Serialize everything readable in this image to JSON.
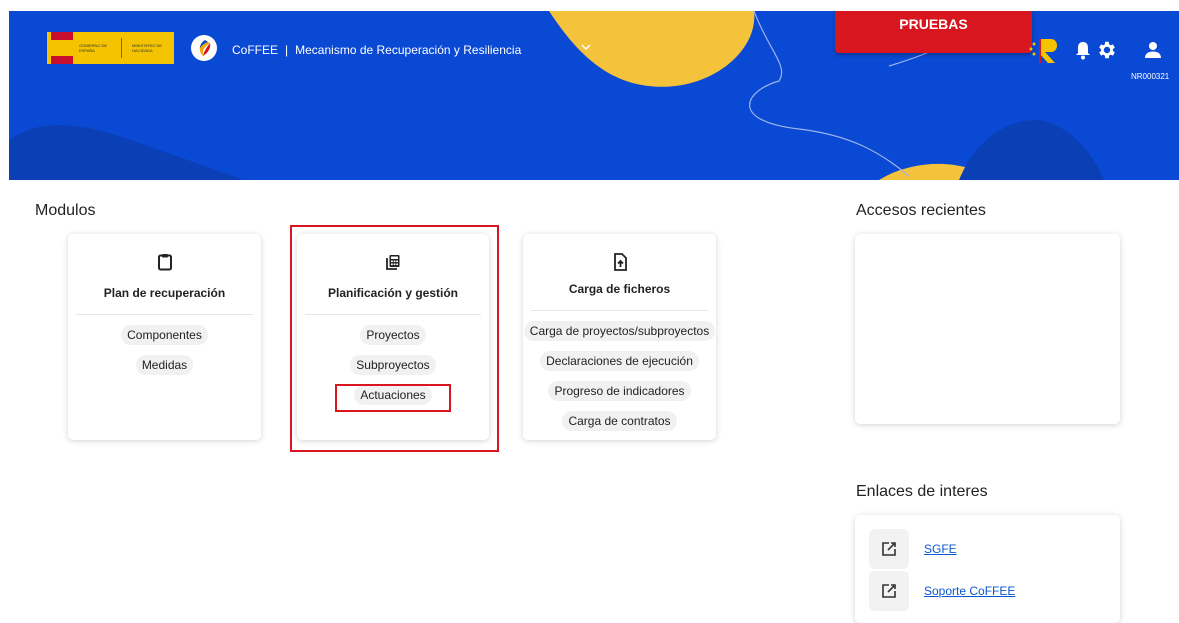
{
  "header": {
    "gov_logo_left_text": "GOBIERNO DE ESPAÑA",
    "gov_logo_right_text": "MINISTERIO DE HACIENDA",
    "app_name": "CoFFEE",
    "separator": "|",
    "app_subtitle": "Mecanismo de Recuperación y Resiliencia",
    "environment_label": "PRUEBAS",
    "user_code": "NR000321",
    "icons": [
      "bell-icon",
      "gear-icon",
      "user-icon",
      "chevron-down-icon"
    ]
  },
  "modules": {
    "title": "Modulos",
    "cards": [
      {
        "title": "Plan de recuperación",
        "icon": "clipboard-icon",
        "items": [
          "Componentes",
          "Medidas"
        ]
      },
      {
        "title": "Planificación y gestión",
        "icon": "calculator-icon",
        "items": [
          "Proyectos",
          "Subproyectos",
          "Actuaciones"
        ]
      },
      {
        "title": "Carga de ficheros",
        "icon": "file-upload-icon",
        "items": [
          "Carga de proyectos/subproyectos",
          "Declaraciones de ejecución",
          "Progreso de indicadores",
          "Carga de contratos"
        ]
      }
    ]
  },
  "recent": {
    "title": "Accesos recientes"
  },
  "links": {
    "title": "Enlaces de interes",
    "items": [
      "SGFE",
      "Soporte CoFFEE"
    ],
    "icon": "external-link-icon"
  },
  "colors": {
    "header_blue": "#0a49d4",
    "accent_yellow": "#f5c400",
    "alert_red": "#d8161f",
    "link_blue": "#0b57d0"
  }
}
